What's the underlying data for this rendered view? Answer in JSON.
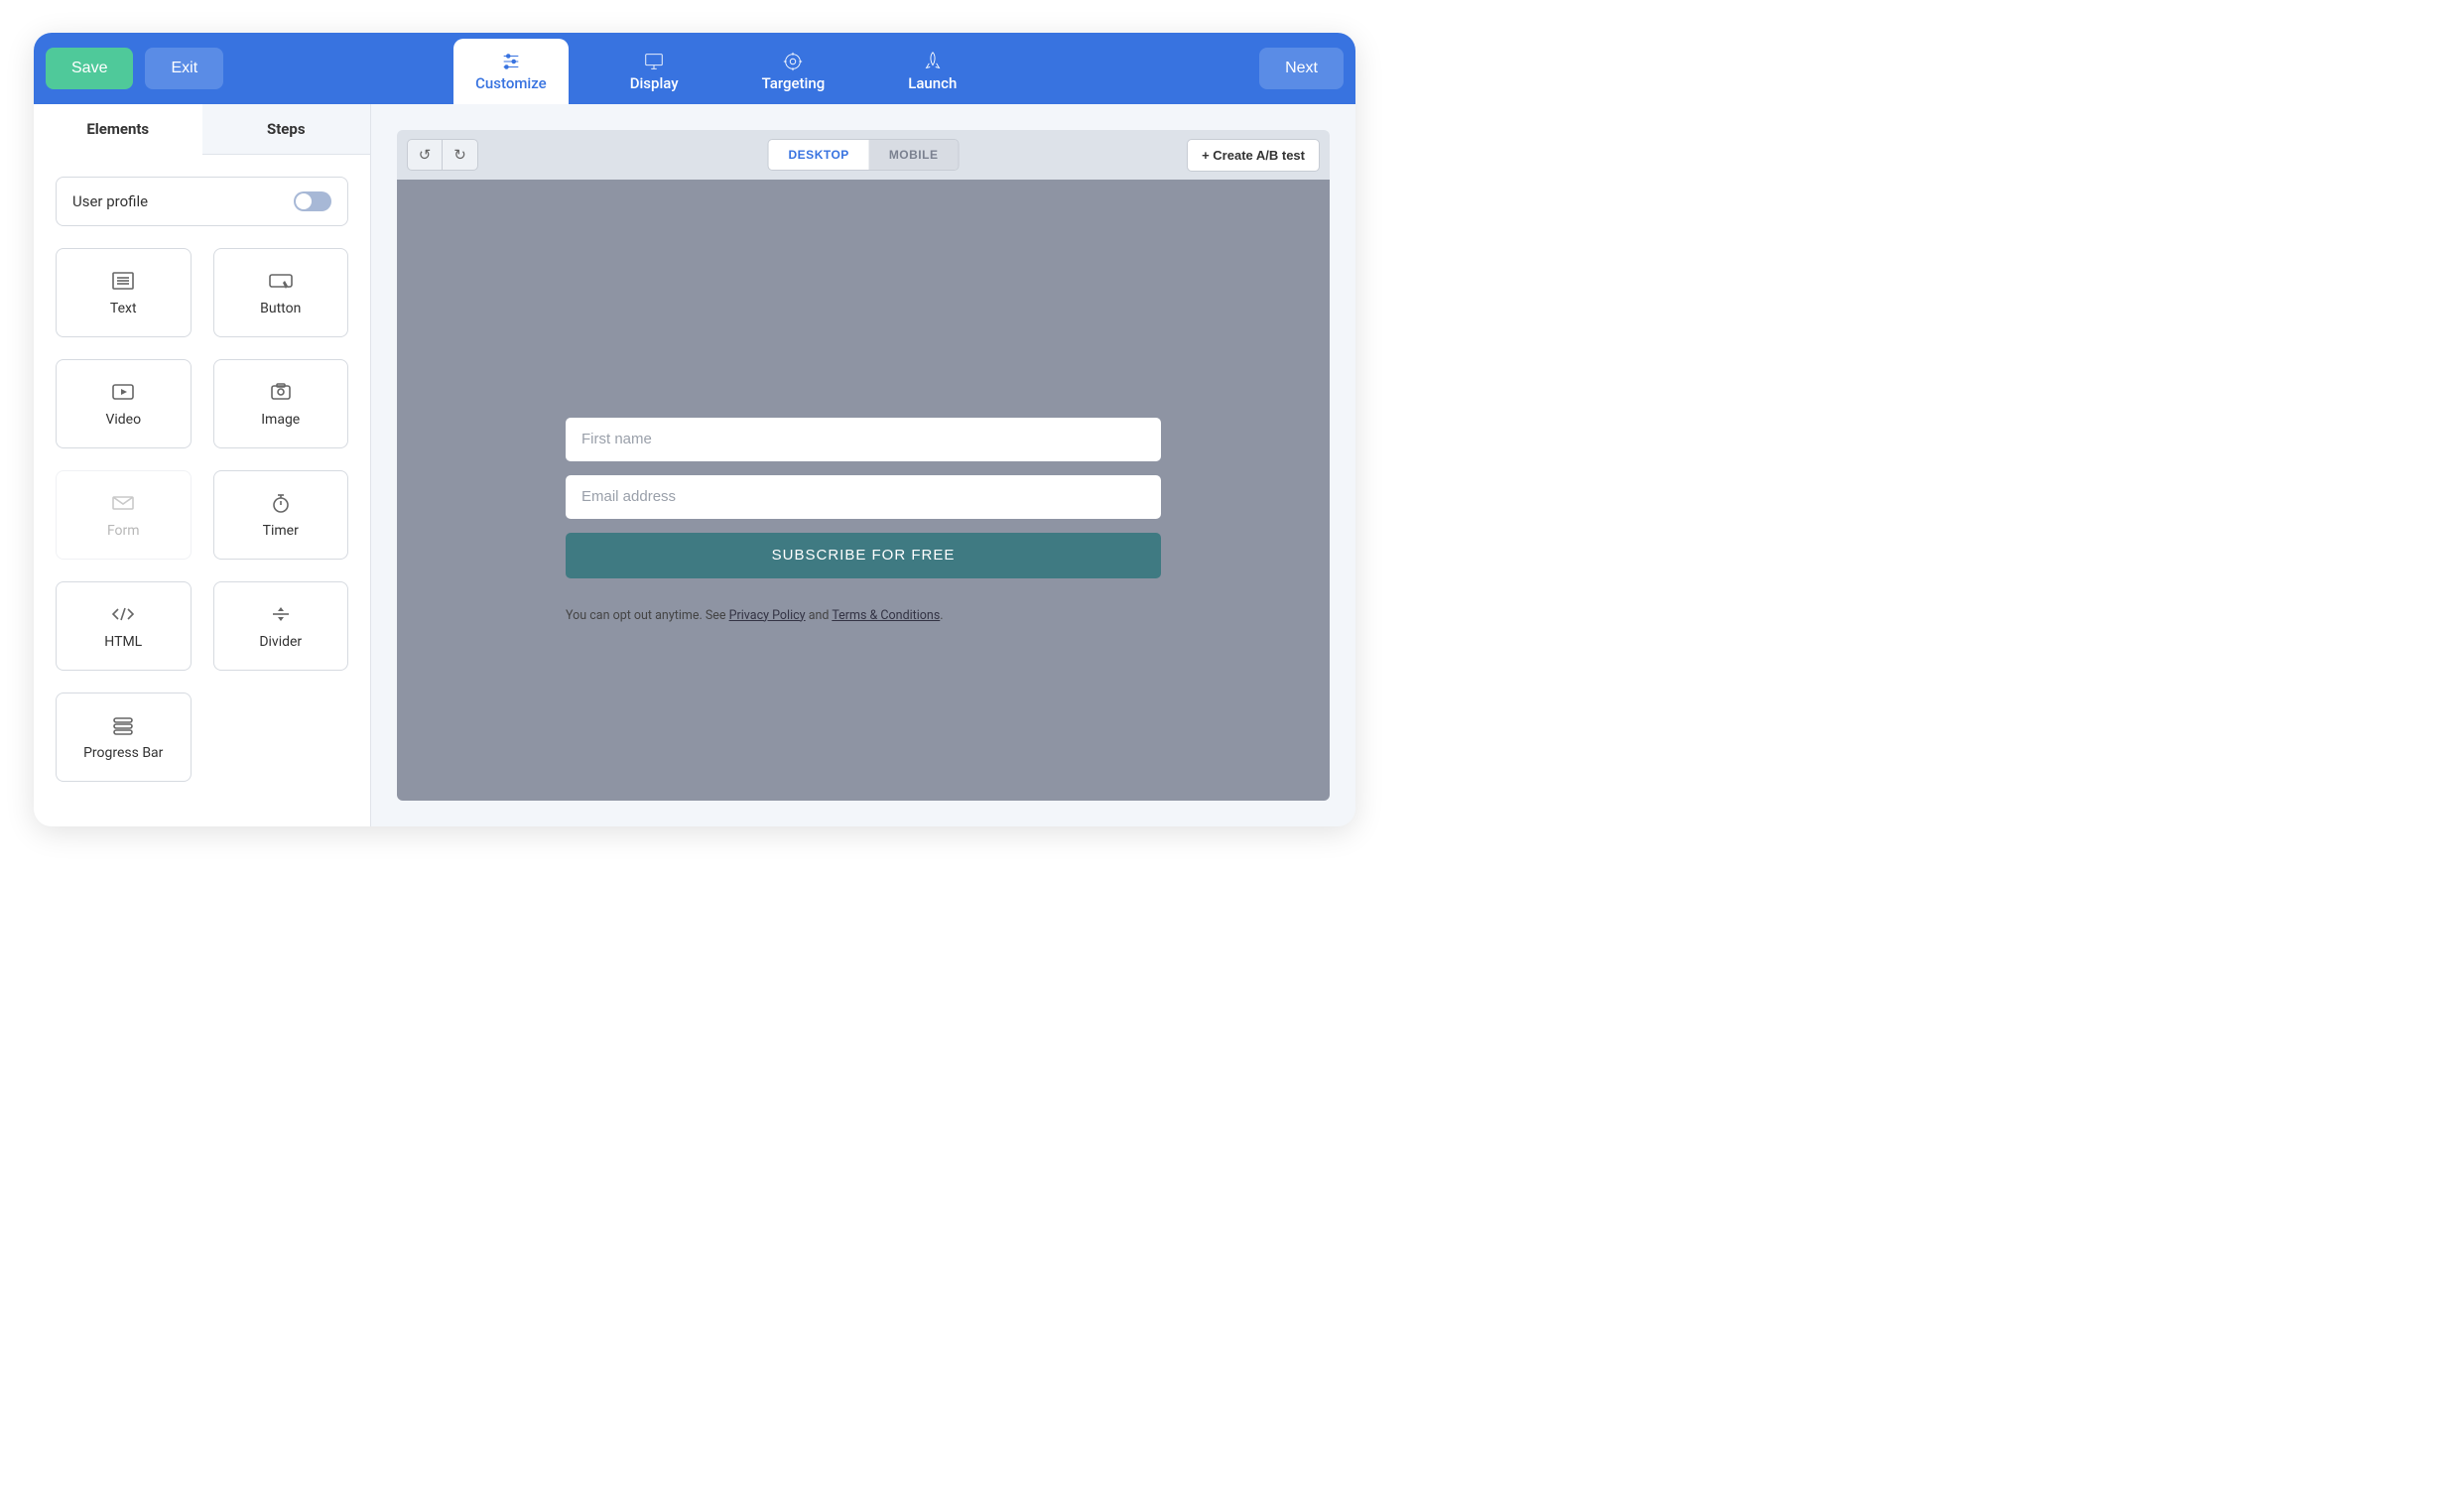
{
  "topbar": {
    "save": "Save",
    "exit": "Exit",
    "next": "Next",
    "nav": {
      "customize": "Customize",
      "display": "Display",
      "targeting": "Targeting",
      "launch": "Launch"
    }
  },
  "sidebar": {
    "tab_elements": "Elements",
    "tab_steps": "Steps",
    "profile_label": "User profile",
    "tiles": {
      "text": "Text",
      "button": "Button",
      "video": "Video",
      "image": "Image",
      "form": "Form",
      "timer": "Timer",
      "html": "HTML",
      "divider": "Divider",
      "progress": "Progress Bar"
    }
  },
  "canvasbar": {
    "desktop": "DESKTOP",
    "mobile": "MOBILE",
    "ab": "+ Create A/B test"
  },
  "form": {
    "fname_ph": "First name",
    "email_ph": "Email address",
    "subscribe": "SUBSCRIBE FOR FREE",
    "legal_pre": "You can opt out anytime. See ",
    "privacy": "Privacy Policy",
    "legal_and": " and ",
    "terms": "Terms & Conditions",
    "legal_post": "."
  }
}
